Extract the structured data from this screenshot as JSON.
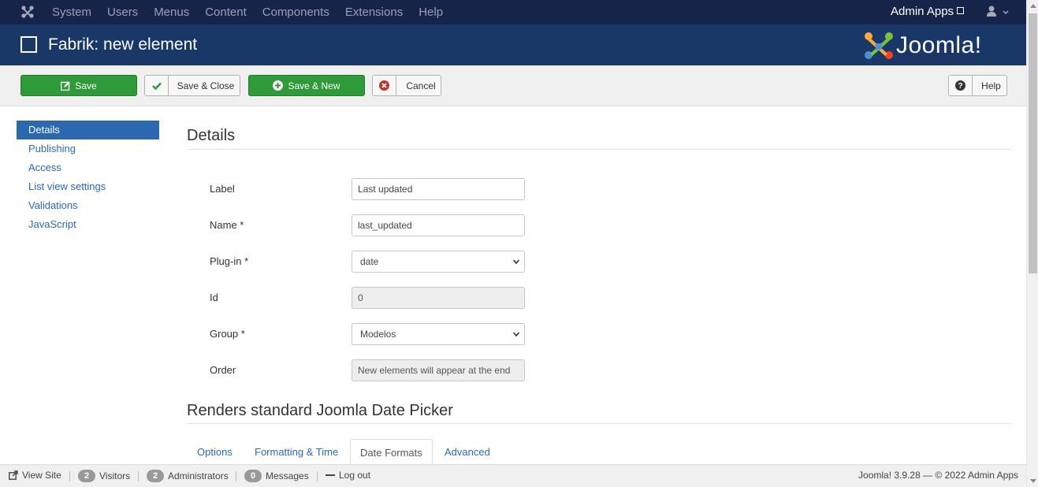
{
  "navbar": {
    "menu": [
      "System",
      "Users",
      "Menus",
      "Content",
      "Components",
      "Extensions",
      "Help"
    ],
    "admin_label": "Admin Apps"
  },
  "header": {
    "title": "Fabrik: new element",
    "brand": "Joomla!"
  },
  "toolbar": {
    "save": "Save",
    "save_close": "Save & Close",
    "save_new": "Save & New",
    "cancel": "Cancel",
    "help": "Help"
  },
  "sidebar": {
    "items": [
      {
        "label": "Details",
        "active": true
      },
      {
        "label": "Publishing"
      },
      {
        "label": "Access"
      },
      {
        "label": "List view settings"
      },
      {
        "label": "Validations"
      },
      {
        "label": "JavaScript"
      }
    ]
  },
  "details": {
    "heading": "Details",
    "fields": {
      "label": {
        "label": "Label",
        "value": "Last updated"
      },
      "name": {
        "label": "Name *",
        "value": "last_updated"
      },
      "plugin": {
        "label": "Plug-in *",
        "value": "date"
      },
      "id": {
        "label": "Id",
        "value": "0"
      },
      "group": {
        "label": "Group *",
        "value": "Modelos"
      },
      "order": {
        "label": "Order",
        "value": "New elements will appear at the end"
      }
    }
  },
  "plugin_section": {
    "heading": "Renders standard Joomla Date Picker",
    "tabs": [
      "Options",
      "Formatting & Time",
      "Date Formats",
      "Advanced"
    ],
    "active_tab": "Date Formats"
  },
  "statusbar": {
    "view_site": "View Site",
    "visitors_count": "2",
    "visitors": "Visitors",
    "admins_count": "2",
    "admins": "Administrators",
    "messages_count": "0",
    "messages": "Messages",
    "logout": "Log out",
    "copyright": "Joomla! 3.9.28 — © 2022 Admin Apps"
  },
  "colors": {
    "navbar": "#17244a",
    "header": "#1a3867",
    "success": "#2f9a3a",
    "link": "#2a69b8",
    "active_nav": "#2b68b0"
  }
}
